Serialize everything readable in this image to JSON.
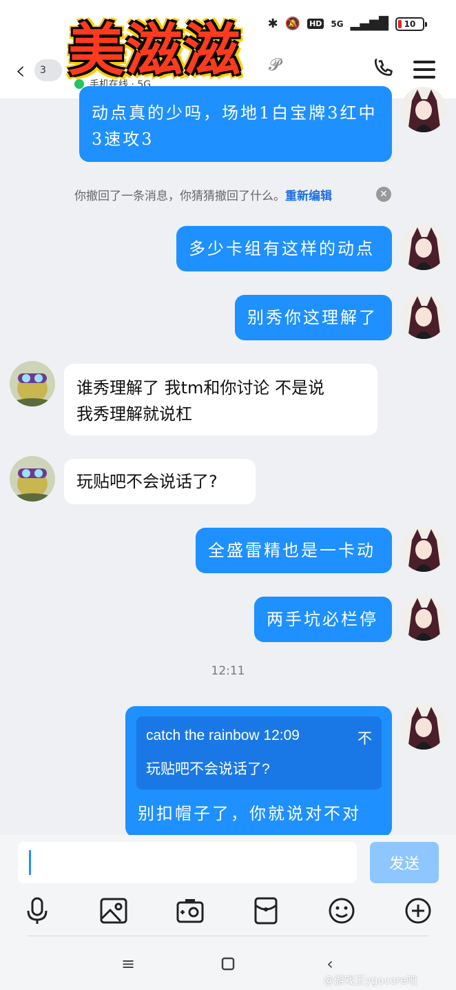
{
  "status_bar": {
    "hd": "HD",
    "network": "5G",
    "battery": "10"
  },
  "header": {
    "unread_count": "3",
    "online_status": "手机在线 · 5G",
    "logo_text": "美滋滋"
  },
  "messages": [
    {
      "side": "right",
      "lines": [
        "动点真的少吗，场地1白宝牌3红中",
        "3速攻3"
      ]
    },
    {
      "side": "right",
      "lines": [
        "多少卡组有这样的动点"
      ]
    },
    {
      "side": "right",
      "lines": [
        "别秀你这理解了"
      ]
    },
    {
      "side": "left",
      "lines": [
        "谁秀理解了 我tm和你讨论 不是说",
        "我秀理解就说杠"
      ]
    },
    {
      "side": "left",
      "lines": [
        "玩贴吧不会说话了?"
      ]
    },
    {
      "side": "right",
      "lines": [
        "全盛雷精也是一卡动"
      ]
    },
    {
      "side": "right",
      "lines": [
        "两手坑必栏停"
      ]
    }
  ],
  "system_note": {
    "text": "你撤回了一条消息，你猜猜撤回了什么。",
    "action": "重新编辑"
  },
  "timestamp": "12:11",
  "reply_message": {
    "quote_author_time": "catch the rainbow 12:09",
    "quote_suffix": "不",
    "quote_text": "玩贴吧不会说话了?",
    "text": "别扣帽子了，你就说对不对"
  },
  "input": {
    "value": "",
    "send_label": "发送"
  },
  "toolbar": {
    "icons": [
      "mic-icon",
      "photo-icon",
      "camera-icon",
      "red-packet-icon",
      "emoji-icon",
      "plus-icon"
    ]
  },
  "watermark": "@游戏王ygocore吧",
  "colors": {
    "bubble_self": "#1e90ff",
    "bubble_other": "#ffffff",
    "send_disabled": "#8ec6ff",
    "link": "#1e6fe0"
  }
}
